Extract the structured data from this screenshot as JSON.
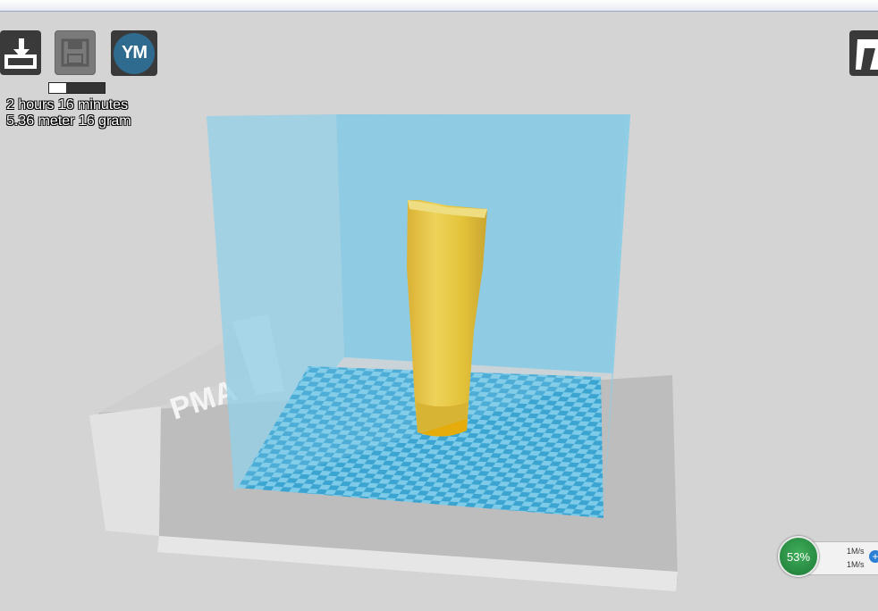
{
  "print": {
    "time": "2 hours 16 minutes",
    "material": "5.36 meter 16 gram",
    "progress_fraction": 0.3
  },
  "toolbar": {
    "load_icon": "load-model-icon",
    "save_icon": "save-icon",
    "ym_label": "YM",
    "right_icon": "view-mode-icon"
  },
  "printer": {
    "bed_logo": "PMA"
  },
  "net_monitor": {
    "percent": "53%",
    "upload": "1M/s",
    "download": "1M/s"
  },
  "colors": {
    "background": "#d4d4d4",
    "build_volume": "#7ec8e3",
    "model": "#f2be12",
    "checker_light": "#7dcbe8",
    "checker_dark": "#3ba4d1"
  }
}
